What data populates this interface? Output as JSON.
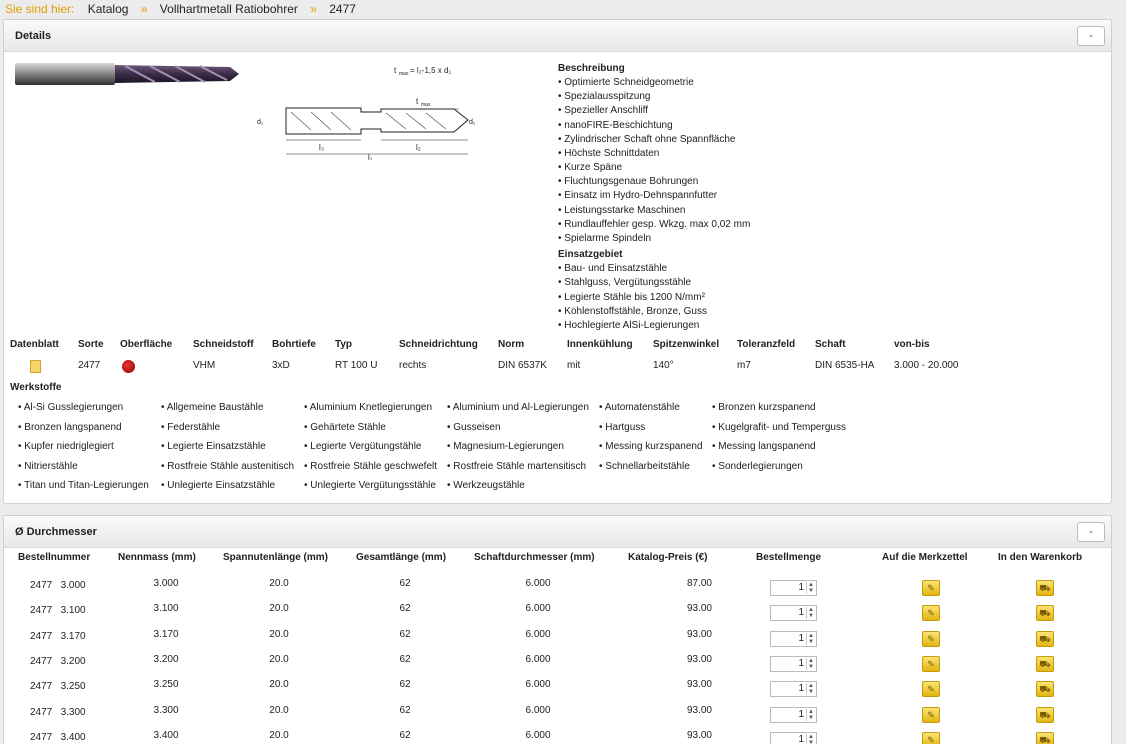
{
  "breadcrumb": {
    "label": "Sie sind hier:",
    "items": [
      "Katalog",
      "Vollhartmetall Ratiobohrer",
      "2477"
    ],
    "separator": "»"
  },
  "details": {
    "title": "Details",
    "collapse_label": "-",
    "diagram": {
      "formula": "t max = l2-1,5 x d1",
      "labels": [
        "t max",
        "d1",
        "d1",
        "l3",
        "l2",
        "l1"
      ]
    },
    "beschreibung_title": "Beschreibung",
    "beschreibung": [
      "Optimierte Schneidgeometrie",
      "Spezialausspitzung",
      "Spezieller Anschliff",
      "nanoFIRE-Beschichtung",
      "Zylindrischer Schaft ohne Spannfläche",
      "Höchste Schnittdaten",
      "Kurze Späne",
      "Fluchtungsgenaue Bohrungen",
      "Einsatz im Hydro-Dehnspannfutter",
      "Leistungsstarke Maschinen",
      "Rundlauffehler gesp. Wkzg. max 0,02 mm",
      "Spielarme Spindeln"
    ],
    "einsatz_title": "Einsatzgebiet",
    "einsatz": [
      "Bau- und Einsatzstähle",
      "Stahlguss, Vergütungsstähle",
      "Legierte Stähle bis 1200 N/mm²",
      "Kohlenstoffstähle, Bronze, Guss",
      "Hochlegierte AlSi-Legierungen"
    ],
    "specs": [
      {
        "label": "Datenblatt",
        "value": ""
      },
      {
        "label": "Sorte",
        "value": "2477"
      },
      {
        "label": "Oberfläche",
        "value": ""
      },
      {
        "label": "Schneidstoff",
        "value": "VHM"
      },
      {
        "label": "Bohrtiefe",
        "value": "3xD"
      },
      {
        "label": "Typ",
        "value": "RT 100 U"
      },
      {
        "label": "Schneidrichtung",
        "value": "rechts"
      },
      {
        "label": "Norm",
        "value": "DIN 6537K"
      },
      {
        "label": "Innenkühlung",
        "value": "mit"
      },
      {
        "label": "Spitzenwinkel",
        "value": "140°"
      },
      {
        "label": "Toleranzfeld",
        "value": "m7"
      },
      {
        "label": "Schaft",
        "value": "DIN 6535-HA"
      },
      {
        "label": "von-bis",
        "value": "3.000 - 20.000"
      }
    ],
    "werkstoffe_title": "Werkstoffe",
    "werkstoffe_cols": [
      [
        "Al-Si Gusslegierungen",
        "Bronzen langspanend",
        "Kupfer niedriglegiert",
        "Nitrierstähle",
        "Titan und Titan-Legierungen"
      ],
      [
        "Allgemeine Baustähle",
        "Federstähle",
        "Legierte Einsatzstähle",
        "Rostfreie Stähle austenitisch",
        "Unlegierte Einsatzstähle"
      ],
      [
        "Aluminium Knetlegierungen",
        "Gehärtete Stähle",
        "Legierte Vergütungstähle",
        "Rostfreie Stähle geschwefelt",
        "Unlegierte Vergütungsstähle"
      ],
      [
        "Aluminium und Al-Legierungen",
        "Gusseisen",
        "Magnesium-Legierungen",
        "Rostfreie Stähle martensitisch",
        "Werkzeugstähle"
      ],
      [
        "Automatenstähle",
        "Hartguss",
        "Messing kurzspanend",
        "Schnellarbeitstähle"
      ],
      [
        "Bronzen kurzspanend",
        "Kugelgrafit- und Temperguss",
        "Messing langspanend",
        "Sonderlegierungen"
      ]
    ]
  },
  "durchmesser": {
    "title": "Ø Durchmesser",
    "collapse_label": "-",
    "headers": [
      "Bestellnummer",
      "Nennmass (mm)",
      "Spannutenlänge (mm)",
      "Gesamtlänge (mm)",
      "Schaftdurchmesser (mm)",
      "Katalog-Preis (€)",
      "Bestellmenge",
      "Auf die Merkzettel",
      "In den Warenkorb"
    ],
    "rows": [
      {
        "nr": "2477",
        "size": "3.000",
        "nenn": "3.000",
        "spann": "20.0",
        "ges": "62",
        "schaft": "6.000",
        "preis": "87.00",
        "qty": "1"
      },
      {
        "nr": "2477",
        "size": "3.100",
        "nenn": "3.100",
        "spann": "20.0",
        "ges": "62",
        "schaft": "6.000",
        "preis": "93.00",
        "qty": "1"
      },
      {
        "nr": "2477",
        "size": "3.170",
        "nenn": "3.170",
        "spann": "20.0",
        "ges": "62",
        "schaft": "6.000",
        "preis": "93.00",
        "qty": "1"
      },
      {
        "nr": "2477",
        "size": "3.200",
        "nenn": "3.200",
        "spann": "20.0",
        "ges": "62",
        "schaft": "6.000",
        "preis": "93.00",
        "qty": "1"
      },
      {
        "nr": "2477",
        "size": "3.250",
        "nenn": "3.250",
        "spann": "20.0",
        "ges": "62",
        "schaft": "6.000",
        "preis": "93.00",
        "qty": "1"
      },
      {
        "nr": "2477",
        "size": "3.300",
        "nenn": "3.300",
        "spann": "20.0",
        "ges": "62",
        "schaft": "6.000",
        "preis": "93.00",
        "qty": "1"
      },
      {
        "nr": "2477",
        "size": "3.400",
        "nenn": "3.400",
        "spann": "20.0",
        "ges": "62",
        "schaft": "6.000",
        "preis": "93.00",
        "qty": "1"
      }
    ]
  },
  "icons": {
    "datasheet": "pdf-icon",
    "surface": "surface-coating-icon",
    "notepad": "notepad-icon",
    "cart": "cart-icon"
  },
  "colors": {
    "breadcrumb_accent": "#e0a000",
    "button_yellow": "#f2c833",
    "surface_red": "#cc1f1f"
  }
}
